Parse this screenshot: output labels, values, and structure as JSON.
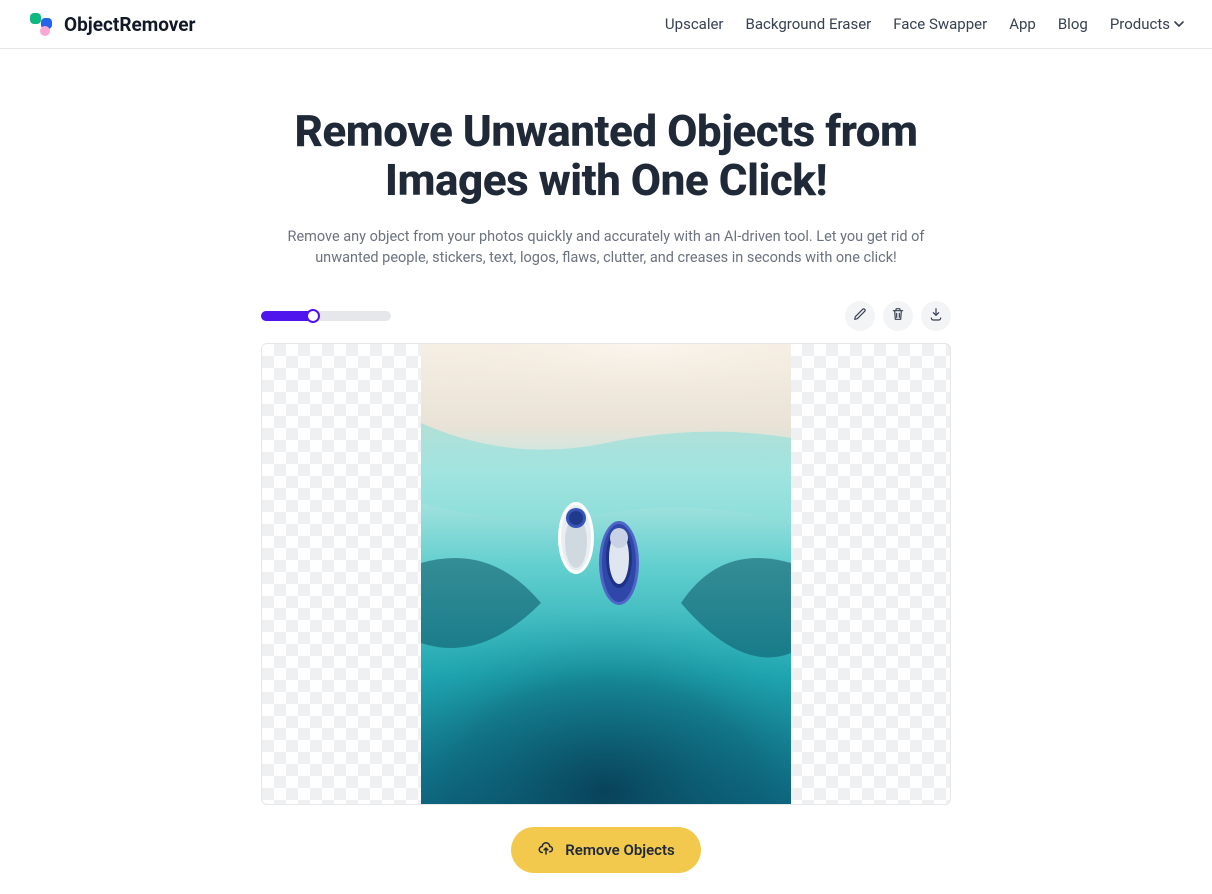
{
  "brand": "ObjectRemover",
  "nav": {
    "items": [
      "Upscaler",
      "Background Eraser",
      "Face Swapper",
      "App",
      "Blog",
      "Products"
    ]
  },
  "hero": {
    "title": "Remove Unwanted Objects from Images with One Click!",
    "subtitle": "Remove any object from your photos quickly and accurately with an AI-driven tool. Let you get rid of unwanted people, stickers, text, logos, flaws, clutter, and creases in seconds with one click!"
  },
  "toolbar": {
    "brush_size_percent": 40,
    "icons": {
      "edit": "edit-icon",
      "delete": "trash-icon",
      "download": "download-icon"
    }
  },
  "cta": {
    "label": "Remove Objects"
  }
}
